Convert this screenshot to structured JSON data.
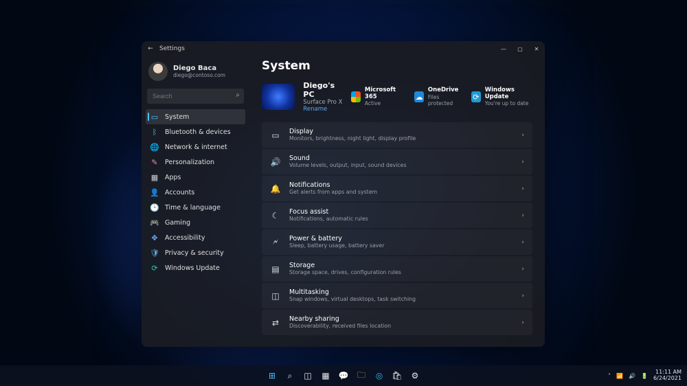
{
  "window": {
    "app_title": "Settings",
    "back_glyph": "←",
    "min_glyph": "—",
    "max_glyph": "▢",
    "close_glyph": "✕"
  },
  "profile": {
    "name": "Diego Baca",
    "email": "diego@contoso.com"
  },
  "search": {
    "placeholder": "Search",
    "icon": "⌕"
  },
  "sidebar": {
    "items": [
      {
        "label": "System",
        "selected": true,
        "icon": "▭"
      },
      {
        "label": "Bluetooth & devices",
        "icon": "ᛒ"
      },
      {
        "label": "Network & internet",
        "icon": "🌐"
      },
      {
        "label": "Personalization",
        "icon": "✎"
      },
      {
        "label": "Apps",
        "icon": "▦"
      },
      {
        "label": "Accounts",
        "icon": "👤"
      },
      {
        "label": "Time & language",
        "icon": "🕑"
      },
      {
        "label": "Gaming",
        "icon": "🎮"
      },
      {
        "label": "Accessibility",
        "icon": "✥"
      },
      {
        "label": "Privacy & security",
        "icon": "🛡"
      },
      {
        "label": "Windows Update",
        "icon": "⟳"
      }
    ]
  },
  "main": {
    "heading": "System",
    "pc": {
      "name": "Diego's PC",
      "model": "Surface Pro X",
      "rename": "Rename"
    },
    "hero_links": [
      {
        "title": "Microsoft 365",
        "subtitle": "Active"
      },
      {
        "title": "OneDrive",
        "subtitle": "Files protected"
      },
      {
        "title": "Windows Update",
        "subtitle": "You're up to date"
      }
    ],
    "items": [
      {
        "title": "Display",
        "subtitle": "Monitors, brightness, night light, display profile",
        "icon": "▭"
      },
      {
        "title": "Sound",
        "subtitle": "Volume levels, output, input, sound devices",
        "icon": "🔊"
      },
      {
        "title": "Notifications",
        "subtitle": "Get alerts from apps and system",
        "icon": "🔔"
      },
      {
        "title": "Focus assist",
        "subtitle": "Notifications, automatic rules",
        "icon": "☾"
      },
      {
        "title": "Power & battery",
        "subtitle": "Sleep, battery usage, battery saver",
        "icon": "🗲"
      },
      {
        "title": "Storage",
        "subtitle": "Storage space, drives, configuration rules",
        "icon": "▤"
      },
      {
        "title": "Multitasking",
        "subtitle": "Snap windows, virtual desktops, task switching",
        "icon": "◫"
      },
      {
        "title": "Nearby sharing",
        "subtitle": "Discoverability, received files location",
        "icon": "⇄"
      }
    ],
    "chev": "›"
  },
  "taskbar": {
    "icons": [
      "start",
      "search",
      "taskview",
      "widgets",
      "chat",
      "explorer",
      "edge",
      "store",
      "settings"
    ],
    "glyphs": {
      "start": "⊞",
      "search": "⌕",
      "taskview": "◫",
      "widgets": "▦",
      "chat": "💬",
      "explorer": "🗀",
      "edge": "◎",
      "store": "🛍",
      "settings": "⚙"
    },
    "tray": {
      "chev": "˄",
      "wifi": "📶",
      "vol": "🔊",
      "bat": "🔋"
    },
    "clock": {
      "time": "11:11 AM",
      "date": "6/24/2021"
    }
  },
  "colors": {
    "accent": "#4cc2ff"
  }
}
